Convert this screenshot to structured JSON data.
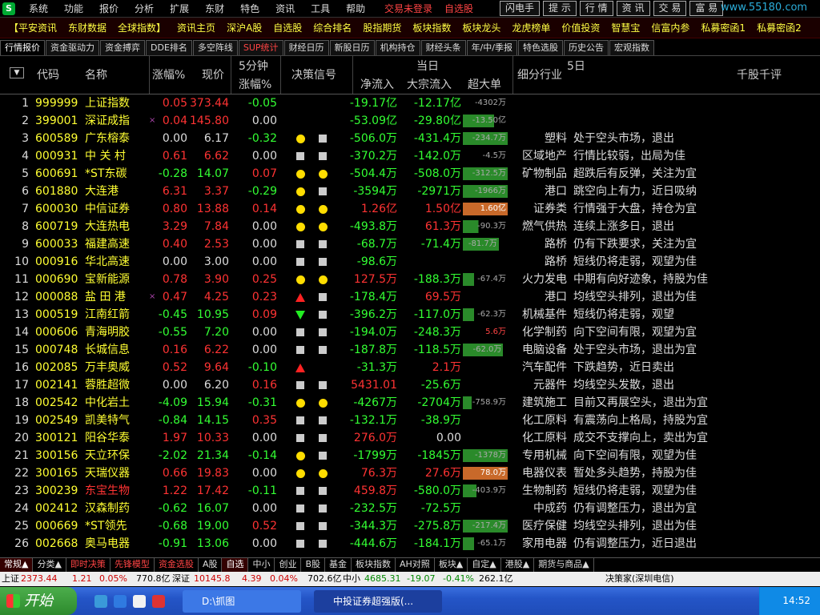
{
  "menubar": {
    "logo": "S",
    "items": [
      "系统",
      "功能",
      "报价",
      "分析",
      "扩展",
      "东财",
      "特色",
      "资讯",
      "工具",
      "帮助"
    ],
    "trade_status": "交易未登录",
    "selfpick": "自选股",
    "buttons": [
      "闪电手",
      "提 示",
      "行 情",
      "资 讯",
      "交 易",
      "富 易"
    ],
    "watermark": "www.55180.com"
  },
  "quickbar": {
    "items": [
      "【平安资讯",
      "东财数据",
      "全球指数】",
      "资讯主页",
      "深沪A股",
      "自选股",
      "综合排名",
      "股指期货",
      "板块指数",
      "板块龙头",
      "龙虎榜单",
      "价值投资",
      "智慧宝",
      "信富内参",
      "私募密函1",
      "私募密函2"
    ]
  },
  "tabs": [
    "行情报价",
    "资金驱动力",
    "资金搏弈",
    "DDE排名",
    "多空阵线",
    "SUP统计",
    "财经日历",
    "新股日历",
    "机构持仓",
    "财经头条",
    "年/中/季报",
    "特色选股",
    "历史公告",
    "宏观指数"
  ],
  "header": {
    "sort": "▼",
    "code": "代码",
    "name": "名称",
    "pct": "涨幅%",
    "price": "现价",
    "m5_top": "5分钟",
    "m5_bottom": "涨幅%",
    "signal": "决策信号",
    "today": "当日",
    "net": "净流入",
    "block": "大宗流入",
    "big": "超大单",
    "industry": "细分行业",
    "five_day": "5日",
    "comment": "千股千评"
  },
  "rows": [
    {
      "i": "1",
      "code": "999999",
      "name": "上证指数",
      "x": "",
      "pct": "0.05",
      "price": "373.44",
      "m5": "-0.05",
      "s1": "",
      "s2": "",
      "net": "-19.17亿",
      "block": "-12.17亿",
      "big": "-4302万",
      "bigType": "green",
      "bigFrac": 0.0,
      "ind": "",
      "cmt": ""
    },
    {
      "i": "2",
      "code": "399001",
      "name": "深证成指",
      "x": "×",
      "pct": "0.04",
      "price": "145.80",
      "m5": "0.00",
      "s1": "",
      "s2": "",
      "net": "-53.09亿",
      "block": "-29.80亿",
      "big": "-13.50亿",
      "bigType": "green",
      "bigFrac": 0.7,
      "ind": "",
      "cmt": ""
    },
    {
      "i": "3",
      "code": "600589",
      "name": "广东榕泰",
      "x": "",
      "pct": "0.00",
      "price": "6.17",
      "m5": "-0.32",
      "s1": "dot",
      "s2": "sq",
      "net": "-506.0万",
      "block": "-431.4万",
      "big": "-234.7万",
      "bigType": "green",
      "bigFrac": 1.0,
      "ind": "塑料",
      "cmt": "处于空头市场，退出"
    },
    {
      "i": "4",
      "code": "000931",
      "name": "中 关 村",
      "x": "",
      "pct": "0.61",
      "price": "6.62",
      "m5": "0.00",
      "s1": "sq",
      "s2": "sq",
      "net": "-370.2万",
      "block": "-142.0万",
      "big": "-4.5万",
      "bigType": "green",
      "bigFrac": 0.0,
      "ind": "区域地产",
      "cmt": "行情比较弱，出局为佳"
    },
    {
      "i": "5",
      "code": "600691",
      "name": "*ST东碳",
      "x": "",
      "pct": "-0.28",
      "price": "14.07",
      "m5": "0.07",
      "s1": "dot",
      "s2": "dot",
      "net": "-504.4万",
      "block": "-508.0万",
      "big": "-312.5万",
      "bigType": "green",
      "bigFrac": 1.0,
      "ind": "矿物制品",
      "cmt": "超跌后有反弹，关注为宜"
    },
    {
      "i": "6",
      "code": "601880",
      "name": "大连港",
      "x": "",
      "pct": "6.31",
      "price": "3.37",
      "m5": "-0.29",
      "s1": "dot",
      "s2": "sq",
      "net": "-3594万",
      "block": "-2971万",
      "big": "-1966万",
      "bigType": "green",
      "bigFrac": 1.0,
      "ind": "港口",
      "cmt": "跳空向上有力，近日吸纳"
    },
    {
      "i": "7",
      "code": "600030",
      "name": "中信证券",
      "x": "",
      "pct": "0.80",
      "price": "13.88",
      "m5": "0.14",
      "s1": "dot",
      "s2": "dot",
      "net": "1.26亿",
      "block": "1.50亿",
      "big": "1.60亿",
      "bigType": "orange",
      "bigFrac": 1.0,
      "ind": "证券类",
      "cmt": "行情强于大盘，持仓为宜"
    },
    {
      "i": "8",
      "code": "600719",
      "name": "大连热电",
      "x": "",
      "pct": "3.29",
      "price": "7.84",
      "m5": "0.00",
      "s1": "dot",
      "s2": "dot",
      "net": "-493.8万",
      "block": "61.3万",
      "big": "-90.3万",
      "bigType": "green",
      "bigFrac": 0.35,
      "ind": "燃气供热",
      "cmt": "连续上涨多日，退出"
    },
    {
      "i": "9",
      "code": "600033",
      "name": "福建高速",
      "x": "",
      "pct": "0.40",
      "price": "2.53",
      "m5": "0.00",
      "s1": "sq",
      "s2": "sq",
      "net": "-68.7万",
      "block": "-71.4万",
      "big": "-81.7万",
      "bigType": "green",
      "bigFrac": 0.8,
      "ind": "路桥",
      "cmt": "仍有下跌要求，关注为宜"
    },
    {
      "i": "10",
      "code": "000916",
      "name": "华北高速",
      "x": "",
      "pct": "0.00",
      "price": "3.00",
      "m5": "0.00",
      "s1": "sq",
      "s2": "sq",
      "net": "-98.6万",
      "block": "",
      "big": "",
      "bigType": "none",
      "bigFrac": 0.0,
      "ind": "路桥",
      "cmt": "短线仍将走弱，观望为佳"
    },
    {
      "i": "11",
      "code": "000690",
      "name": "宝新能源",
      "x": "",
      "pct": "0.78",
      "price": "3.90",
      "m5": "0.25",
      "s1": "dot",
      "s2": "dot",
      "net": "127.5万",
      "block": "-188.3万",
      "big": "-67.4万",
      "bigType": "green",
      "bigFrac": 0.25,
      "ind": "火力发电",
      "cmt": "中期有向好迹象，持股为佳"
    },
    {
      "i": "12",
      "code": "000088",
      "name": "盐 田 港",
      "x": "×",
      "pct": "0.47",
      "price": "4.25",
      "m5": "0.23",
      "s1": "up",
      "s2": "sq",
      "net": "-178.4万",
      "block": "69.5万",
      "big": "",
      "bigType": "none",
      "bigFrac": 0.0,
      "ind": "港口",
      "cmt": "均线空头排列，退出为佳"
    },
    {
      "i": "13",
      "code": "000519",
      "name": "江南红箭",
      "x": "",
      "pct": "-0.45",
      "price": "10.95",
      "m5": "0.09",
      "s1": "down",
      "s2": "sq",
      "net": "-396.2万",
      "block": "-117.0万",
      "big": "-62.3万",
      "bigType": "green",
      "bigFrac": 0.25,
      "ind": "机械基件",
      "cmt": "短线仍将走弱，观望"
    },
    {
      "i": "14",
      "code": "000606",
      "name": "青海明胶",
      "x": "",
      "pct": "-0.55",
      "price": "7.20",
      "m5": "0.00",
      "s1": "sq",
      "s2": "sq",
      "net": "-194.0万",
      "block": "-248.3万",
      "big": "5.6万",
      "bigType": "none",
      "bigFrac": 0.0,
      "ind": "化学制药",
      "cmt": "向下空间有限，观望为宜"
    },
    {
      "i": "15",
      "code": "000748",
      "name": "长城信息",
      "x": "",
      "pct": "0.16",
      "price": "6.22",
      "m5": "0.00",
      "s1": "sq",
      "s2": "sq",
      "net": "-187.8万",
      "block": "-118.5万",
      "big": "-62.0万",
      "bigType": "green",
      "bigFrac": 0.9,
      "ind": "电脑设备",
      "cmt": "处于空头市场，退出为宜"
    },
    {
      "i": "16",
      "code": "002085",
      "name": "万丰奥威",
      "x": "",
      "pct": "0.52",
      "price": "9.64",
      "m5": "-0.10",
      "s1": "up",
      "s2": "",
      "net": "-31.3万",
      "block": "2.1万",
      "big": "",
      "bigType": "none",
      "bigFrac": 0.0,
      "ind": "汽车配件",
      "cmt": "下跌趋势，近日卖出"
    },
    {
      "i": "17",
      "code": "002141",
      "name": "蓉胜超微",
      "x": "",
      "pct": "0.00",
      "price": "6.20",
      "m5": "0.16",
      "s1": "sq",
      "s2": "sq",
      "net": "5431.01",
      "block": "-25.6万",
      "big": "",
      "bigType": "none",
      "bigFrac": 0.0,
      "ind": "元器件",
      "cmt": "均线空头发散，退出"
    },
    {
      "i": "18",
      "code": "002542",
      "name": "中化岩土",
      "x": "",
      "pct": "-4.09",
      "price": "15.94",
      "m5": "-0.31",
      "s1": "dot",
      "s2": "dot",
      "net": "-4267万",
      "block": "-2704万",
      "big": "-758.9万",
      "bigType": "green",
      "bigFrac": 0.2,
      "ind": "建筑施工",
      "cmt": "目前又再展空头，退出为宜"
    },
    {
      "i": "19",
      "code": "002549",
      "name": "凯美特气",
      "x": "",
      "pct": "-0.84",
      "price": "14.15",
      "m5": "0.35",
      "s1": "sq",
      "s2": "sq",
      "net": "-132.1万",
      "block": "-38.9万",
      "big": "",
      "bigType": "none",
      "bigFrac": 0.0,
      "ind": "化工原料",
      "cmt": "有震荡向上格局，持股为宜"
    },
    {
      "i": "20",
      "code": "300121",
      "name": "阳谷华泰",
      "x": "",
      "pct": "1.97",
      "price": "10.33",
      "m5": "0.00",
      "s1": "sq",
      "s2": "sq",
      "net": "276.0万",
      "block": "0.00",
      "big": "",
      "bigType": "none",
      "bigFrac": 0.0,
      "ind": "化工原料",
      "cmt": "成交不支撑向上，卖出为宜"
    },
    {
      "i": "21",
      "code": "300156",
      "name": "天立环保",
      "x": "",
      "pct": "-2.02",
      "price": "21.34",
      "m5": "-0.14",
      "s1": "dot",
      "s2": "sq",
      "net": "-1799万",
      "block": "-1845万",
      "big": "-1378万",
      "bigType": "green",
      "bigFrac": 1.0,
      "ind": "专用机械",
      "cmt": "向下空间有限，观望为佳"
    },
    {
      "i": "22",
      "code": "300165",
      "name": "天瑞仪器",
      "x": "",
      "pct": "0.66",
      "price": "19.83",
      "m5": "0.00",
      "s1": "dot",
      "s2": "dot",
      "net": "76.3万",
      "block": "27.6万",
      "big": "78.0万",
      "bigType": "orange",
      "bigFrac": 1.0,
      "ind": "电器仪表",
      "cmt": "暂处多头趋势，持股为佳"
    },
    {
      "i": "23",
      "code": "300239",
      "name": "东宝生物",
      "x": "",
      "pct": "1.22",
      "price": "17.42",
      "m5": "-0.11",
      "s1": "sq",
      "s2": "sq",
      "net": "459.8万",
      "block": "-580.0万",
      "big": "-403.9万",
      "bigType": "green",
      "bigFrac": 0.3,
      "ind": "生物制药",
      "cmt": "短线仍将走弱，观望为佳",
      "red": true
    },
    {
      "i": "24",
      "code": "002412",
      "name": "汉森制药",
      "x": "",
      "pct": "-0.62",
      "price": "16.07",
      "m5": "0.00",
      "s1": "sq",
      "s2": "sq",
      "net": "-232.5万",
      "block": "-72.5万",
      "big": "",
      "bigType": "none",
      "bigFrac": 0.0,
      "ind": "中成药",
      "cmt": "仍有调整压力，退出为宜"
    },
    {
      "i": "25",
      "code": "000669",
      "name": "*ST领先",
      "x": "",
      "pct": "-0.68",
      "price": "19.00",
      "m5": "0.52",
      "s1": "sq",
      "s2": "sq",
      "net": "-344.3万",
      "block": "-275.8万",
      "big": "-217.4万",
      "bigType": "green",
      "bigFrac": 1.0,
      "ind": "医疗保健",
      "cmt": "均线空头排列，退出为佳"
    },
    {
      "i": "26",
      "code": "002668",
      "name": "奥马电器",
      "x": "",
      "pct": "-0.91",
      "price": "13.06",
      "m5": "0.00",
      "s1": "sq",
      "s2": "sq",
      "net": "-444.6万",
      "block": "-184.1万",
      "big": "-65.1万",
      "bigType": "green",
      "bigFrac": 0.25,
      "ind": "家用电器",
      "cmt": "仍有调整压力，近日退出"
    }
  ],
  "bottomtabs": [
    "常规▲",
    "分类▲",
    "即时决策",
    "先锋模型",
    "资金选股",
    "A股",
    "自选",
    "中小",
    "创业",
    "B股",
    "基金",
    "板块指数",
    "AH对照",
    "板块▲",
    "自定▲",
    "港股▲",
    "期货与商品▲"
  ],
  "indexbar": {
    "sh_label": "上证",
    "sh_value": "2373.44",
    "sh_chg": "1.21",
    "sh_pct": "0.05%",
    "sh_amt": "770.8亿",
    "sz_label": "深证",
    "sz_value": "10145.8",
    "sz_chg": "4.39",
    "sz_pct": "0.04%",
    "sz_amt": "702.6亿",
    "zx_label": "中小",
    "zx_value": "4685.31",
    "zx_chg": "-19.07",
    "zx_pct": "-0.41%",
    "zx_amt": "262.1亿",
    "info": "决策家(深圳电信)"
  },
  "taskbar": {
    "start": "开始",
    "task1": "D:\\抓图",
    "task2": "中投证券超强版(...",
    "time": "14:52"
  }
}
